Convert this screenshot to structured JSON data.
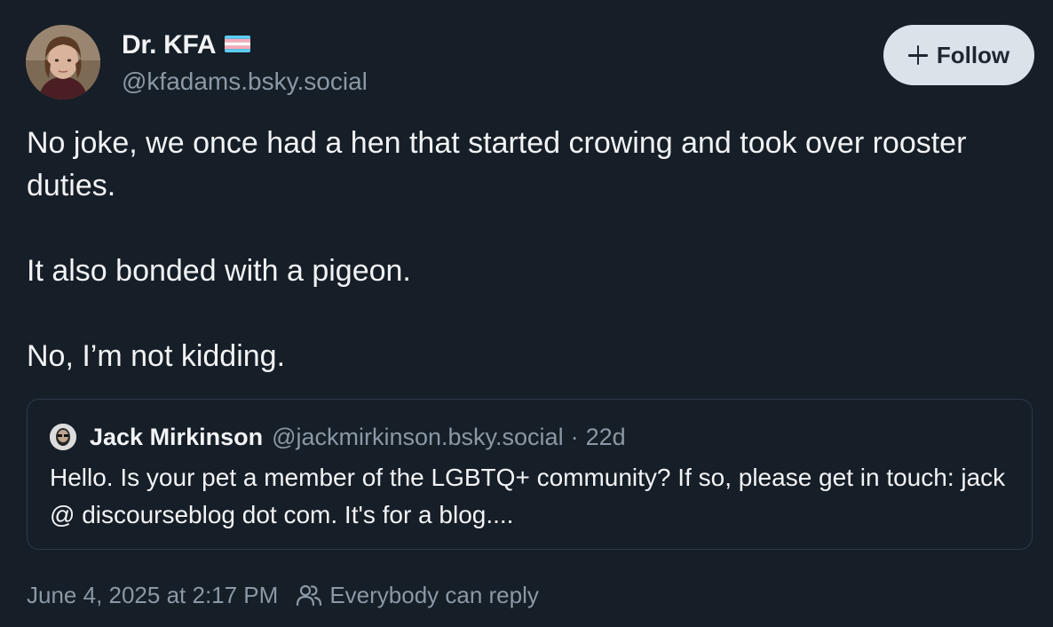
{
  "author": {
    "display_name": "Dr. KFA",
    "handle": "@kfadams.bsky.social"
  },
  "follow_button": {
    "icon": "plus-icon",
    "label": "Follow"
  },
  "post": {
    "paragraphs": [
      "No joke, we once had a hen that started crowing and took over rooster duties.",
      "It also bonded with a pigeon.",
      "No, I’m not kidding."
    ]
  },
  "quote": {
    "author_name": "Jack Mirkinson",
    "handle": "@jackmirkinson.bsky.social",
    "separator": "·",
    "age": "22d",
    "text": "Hello. Is your pet a member of the LGBTQ+ community? If so, please get in touch: jack @ discourseblog dot com. It's for a blog...."
  },
  "meta": {
    "timestamp": "June 4, 2025 at 2:17 PM",
    "reply_icon": "people-icon",
    "reply_setting": "Everybody can reply"
  },
  "colors": {
    "background": "#161e27",
    "text": "#f1f3f5",
    "muted": "#8b98a5",
    "follow_bg": "#dce2ea",
    "card_border": "#2e3b4a",
    "flag_blue": "#5bcefa",
    "flag_pink": "#f5a9b8",
    "flag_white": "#ffffff"
  }
}
